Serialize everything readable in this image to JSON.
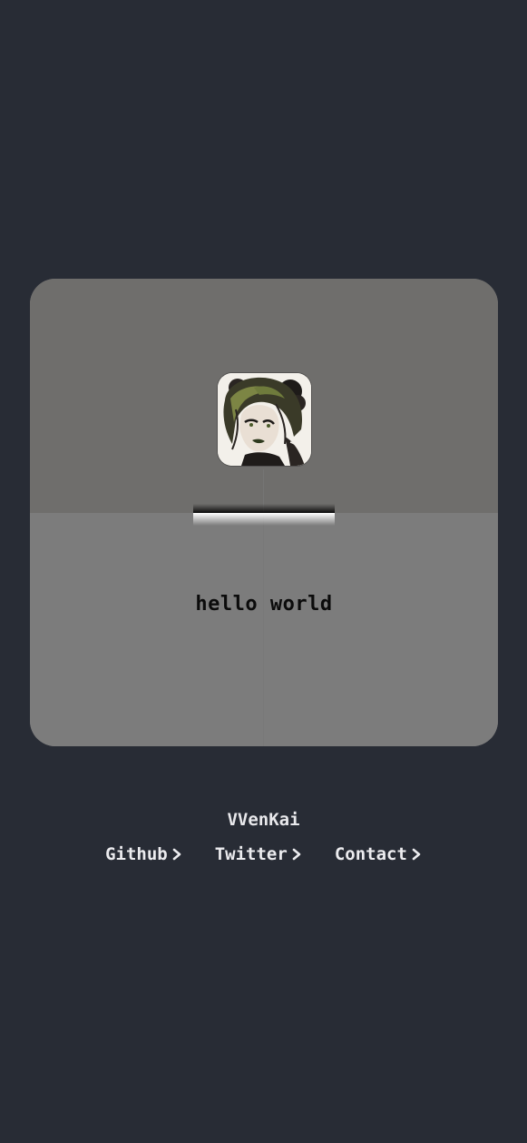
{
  "card": {
    "text": "hello world"
  },
  "profile": {
    "name": "VVenKai"
  },
  "links": [
    {
      "label": "Github"
    },
    {
      "label": "Twitter"
    },
    {
      "label": "Contact"
    }
  ],
  "icons": {
    "link_arrow": "chevron-right-icon"
  },
  "colors": {
    "background": "#282c35",
    "footer_text": "#ececef",
    "card_text": "#0b0b0b"
  }
}
